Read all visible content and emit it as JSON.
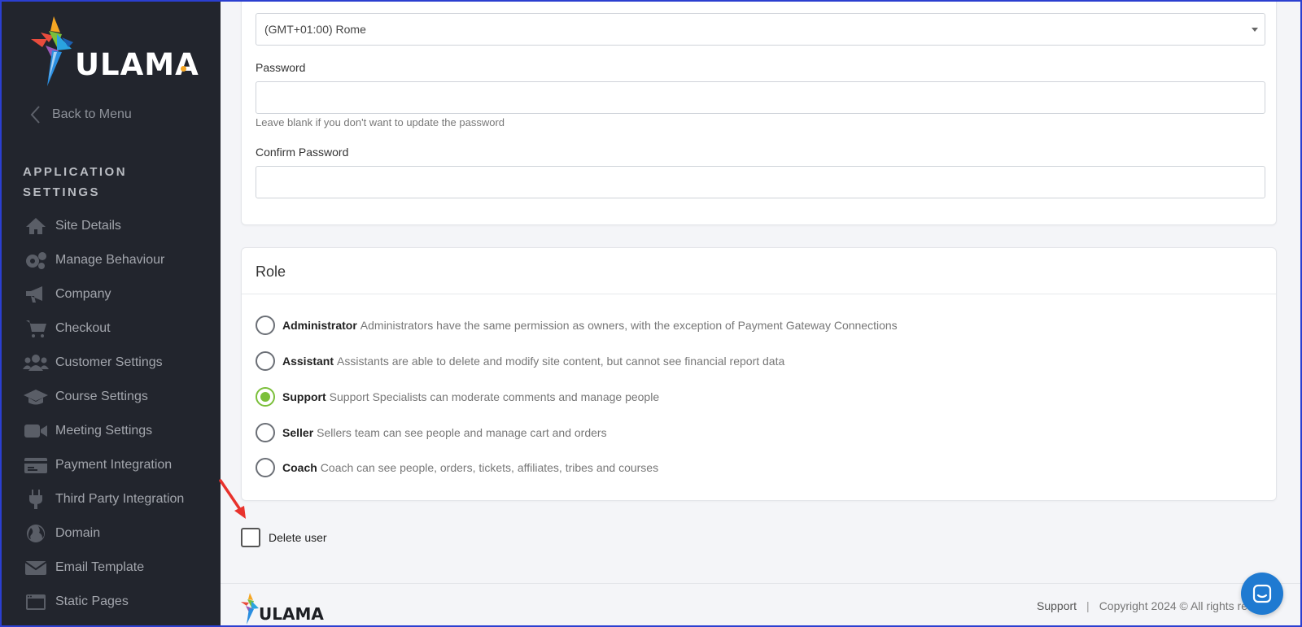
{
  "brand": {
    "name": "ULAMA"
  },
  "sidebar": {
    "back_label": "Back to Menu",
    "section_title": "APPLICATION SETTINGS",
    "items": [
      {
        "label": "Site Details",
        "icon": "home-icon"
      },
      {
        "label": "Manage Behaviour",
        "icon": "gears-icon"
      },
      {
        "label": "Company",
        "icon": "megaphone-icon"
      },
      {
        "label": "Checkout",
        "icon": "cart-icon"
      },
      {
        "label": "Customer Settings",
        "icon": "users-icon"
      },
      {
        "label": "Course Settings",
        "icon": "graduation-cap-icon"
      },
      {
        "label": "Meeting Settings",
        "icon": "video-camera-icon"
      },
      {
        "label": "Payment Integration",
        "icon": "credit-card-icon"
      },
      {
        "label": "Third Party Integration",
        "icon": "plug-icon"
      },
      {
        "label": "Domain",
        "icon": "globe-icon"
      },
      {
        "label": "Email Template",
        "icon": "envelope-icon"
      },
      {
        "label": "Static Pages",
        "icon": "window-icon"
      }
    ]
  },
  "form": {
    "timezone_value": "(GMT+01:00) Rome",
    "password_label": "Password",
    "password_value": "",
    "password_hint": "Leave blank if you don't want to update the password",
    "confirm_password_label": "Confirm Password",
    "confirm_password_value": ""
  },
  "role": {
    "title": "Role",
    "selected": "Support",
    "options": [
      {
        "name": "Administrator",
        "description": "Administrators have the same permission as owners, with the exception of Payment Gateway Connections"
      },
      {
        "name": "Assistant",
        "description": "Assistants are able to delete and modify site content, but cannot see financial report data"
      },
      {
        "name": "Support",
        "description": "Support Specialists can moderate comments and manage people"
      },
      {
        "name": "Seller",
        "description": "Sellers team can see people and manage cart and orders"
      },
      {
        "name": "Coach",
        "description": "Coach can see people, orders, tickets, affiliates, tribes and courses"
      }
    ]
  },
  "delete_user": {
    "label": "Delete user",
    "checked": false
  },
  "footer": {
    "support_label": "Support",
    "separator": "|",
    "copyright": "Copyright 2024 © All rights re"
  },
  "colors": {
    "sidebar_bg": "#22252d",
    "accent_green": "#7bbf3a",
    "chat_blue": "#1f7ad1",
    "annotation_red": "#e8322c"
  }
}
